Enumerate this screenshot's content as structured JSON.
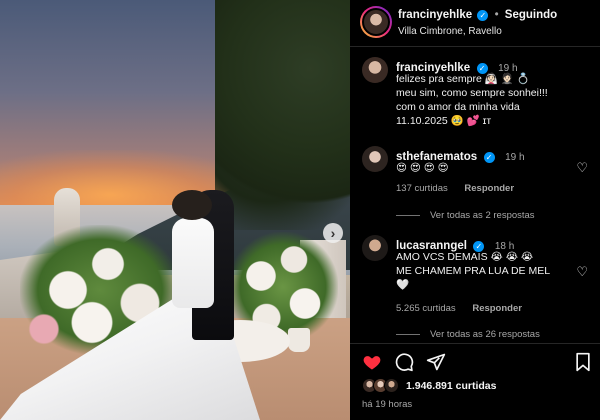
{
  "post": {
    "username": "francinyehlke",
    "follow_status": "Seguindo",
    "location": "Villa Cimbrone, Ravello",
    "separator": "•",
    "verified_glyph": "✓"
  },
  "caption": {
    "username": "francinyehlke",
    "time": "19 h",
    "lines": [
      "felizes pra sempre 👰🏻 🤵🏻 💍",
      "meu sim, como sempre sonhei!!!",
      "com o amor da minha vida",
      "11.10.2025 🥹 💕 ɪᴛ"
    ]
  },
  "comments": [
    {
      "username": "sthefanematos",
      "time": "19 h",
      "text": "😍 😍 😍 😍",
      "likes": "137 curtidas",
      "reply_label": "Responder",
      "more_replies": "Ver todas as 2 respostas"
    },
    {
      "username": "lucasranngel",
      "time": "18 h",
      "text_lines": [
        "AMO VCS DEMAIS 😭 😭 😭",
        "ME CHAMEM PRA LUA DE MEL",
        "🤍"
      ],
      "likes": "5.265 curtidas",
      "reply_label": "Responder",
      "more_replies": "Ver todas as 26 respostas"
    }
  ],
  "actions": {
    "like_icon": "heart-filled-icon",
    "comment_icon": "comment-bubble-icon",
    "share_icon": "paper-plane-icon",
    "save_icon": "bookmark-icon"
  },
  "likes_summary": "1.946.891 curtidas",
  "posted_ago": "há 19 horas",
  "colors": {
    "verified": "#0095f6",
    "like_red": "#ff3040",
    "muted_text": "#a8a8a8"
  }
}
